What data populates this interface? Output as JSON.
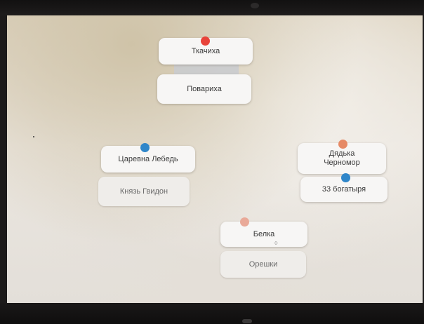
{
  "cards": {
    "tkachikha": "Ткачиха",
    "povarikha": "Повариха",
    "tsarevna": "Царевна Лебедь",
    "gvidon": "Князь Гвидон",
    "dyadka_line1": "Дядька",
    "dyadka_line2": "Черномор",
    "bogatyrya": "33 богатыря",
    "belka": "Белка",
    "oreshki": "Орешки"
  },
  "colors": {
    "red_dot": "#e8433a",
    "blue_dot": "#2f86c9",
    "orange_dot": "#e68a66",
    "peach_dot": "#e9a998"
  },
  "icons": {
    "belka_handle": "÷"
  }
}
